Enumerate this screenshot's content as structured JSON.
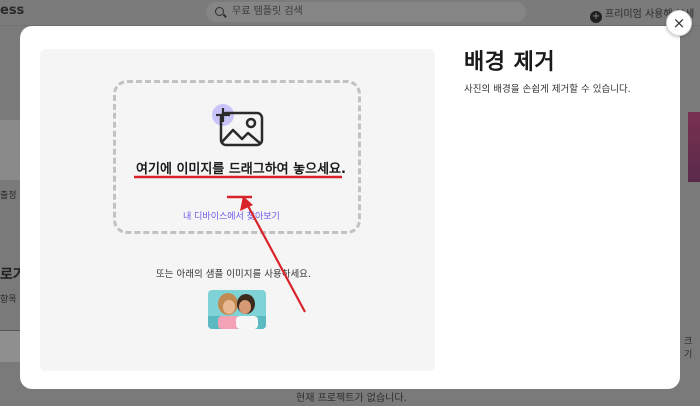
{
  "background": {
    "logo": "ess",
    "search_placeholder": "무료 템플릿 검색",
    "premium_label": "프리미엄 사용해 보세",
    "left_text_1": "출정",
    "left_text_2": "로거",
    "left_text_3": "항목",
    "right_text": "크기",
    "bottom_text": "현재 프로젝트가 없습니다."
  },
  "modal": {
    "title": "배경 제거",
    "description": "사진의 배경을 손쉽게 제거할 수 있습니다.",
    "dropzone": {
      "title": "여기에 이미지를 드래그하여 놓으세요.",
      "browse_link": "내 디바이스에서 찾아보기",
      "icon": "add-image-icon"
    },
    "sample_text": "또는 아래의 샘플 이미지를 사용하세요.",
    "close_label": "×"
  },
  "colors": {
    "accent": "#6a5ae6",
    "annotation_red": "#d8232a",
    "icon_purple": "#c7c2f7"
  }
}
